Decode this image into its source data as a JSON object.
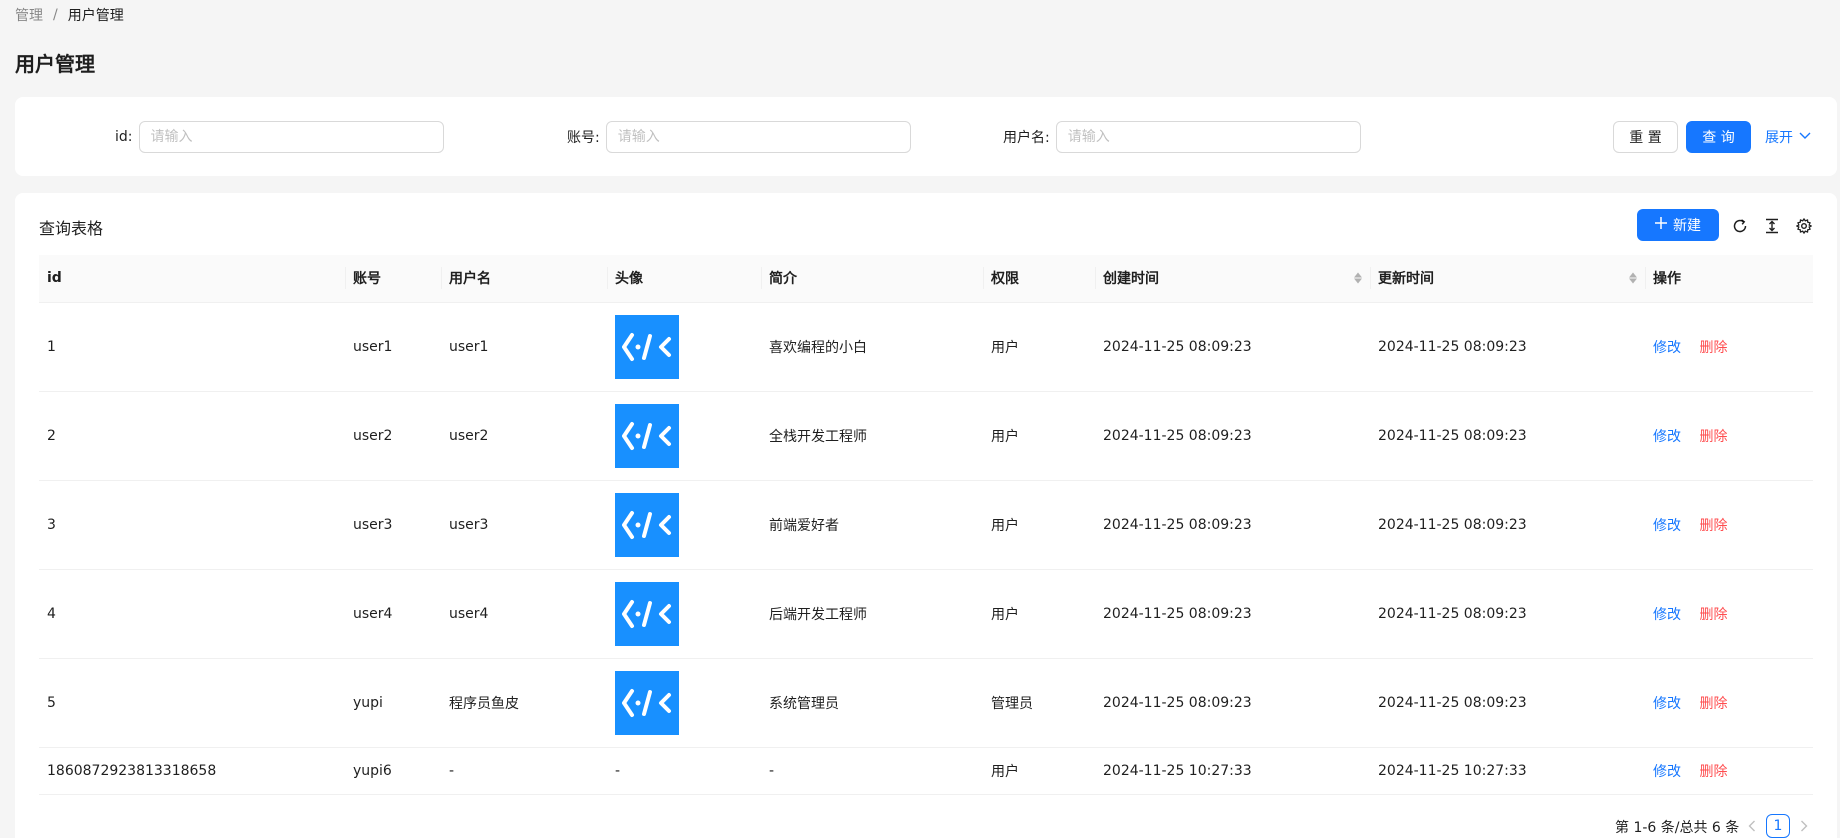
{
  "breadcrumb": {
    "parent": "管理",
    "separator": "/",
    "current": "用户管理"
  },
  "page_title": "用户管理",
  "search": {
    "fields": [
      {
        "label": "id:",
        "placeholder": "请输入"
      },
      {
        "label": "账号:",
        "placeholder": "请输入"
      },
      {
        "label": "用户名:",
        "placeholder": "请输入"
      }
    ],
    "reset_label": "重 置",
    "query_label": "查 询",
    "expand_label": "展开"
  },
  "table": {
    "title": "查询表格",
    "new_label": "新建",
    "columns": [
      "id",
      "账号",
      "用户名",
      "头像",
      "简介",
      "权限",
      "创建时间",
      "更新时间",
      "操作"
    ],
    "rows": [
      {
        "id": "1",
        "account": "user1",
        "username": "user1",
        "avatar": "code-logo",
        "bio": "喜欢编程的小白",
        "role": "用户",
        "created": "2024-11-25 08:09:23",
        "updated": "2024-11-25 08:09:23"
      },
      {
        "id": "2",
        "account": "user2",
        "username": "user2",
        "avatar": "code-logo",
        "bio": "全栈开发工程师",
        "role": "用户",
        "created": "2024-11-25 08:09:23",
        "updated": "2024-11-25 08:09:23"
      },
      {
        "id": "3",
        "account": "user3",
        "username": "user3",
        "avatar": "code-logo",
        "bio": "前端爱好者",
        "role": "用户",
        "created": "2024-11-25 08:09:23",
        "updated": "2024-11-25 08:09:23"
      },
      {
        "id": "4",
        "account": "user4",
        "username": "user4",
        "avatar": "code-logo",
        "bio": "后端开发工程师",
        "role": "用户",
        "created": "2024-11-25 08:09:23",
        "updated": "2024-11-25 08:09:23"
      },
      {
        "id": "5",
        "account": "yupi",
        "username": "程序员鱼皮",
        "avatar": "code-logo",
        "bio": "系统管理员",
        "role": "管理员",
        "created": "2024-11-25 08:09:23",
        "updated": "2024-11-25 08:09:23"
      },
      {
        "id": "1860872923813318658",
        "account": "yupi6",
        "username": "-",
        "avatar": "-",
        "bio": "-",
        "role": "用户",
        "created": "2024-11-25 10:27:33",
        "updated": "2024-11-25 10:27:33"
      }
    ],
    "edit_label": "修改",
    "delete_label": "删除"
  },
  "pagination": {
    "total_text": "第 1-6 条/总共 6 条",
    "current_page": "1"
  },
  "colors": {
    "primary": "#1677ff",
    "danger": "#ff4d4f",
    "avatar_bg": "#1890ff"
  }
}
